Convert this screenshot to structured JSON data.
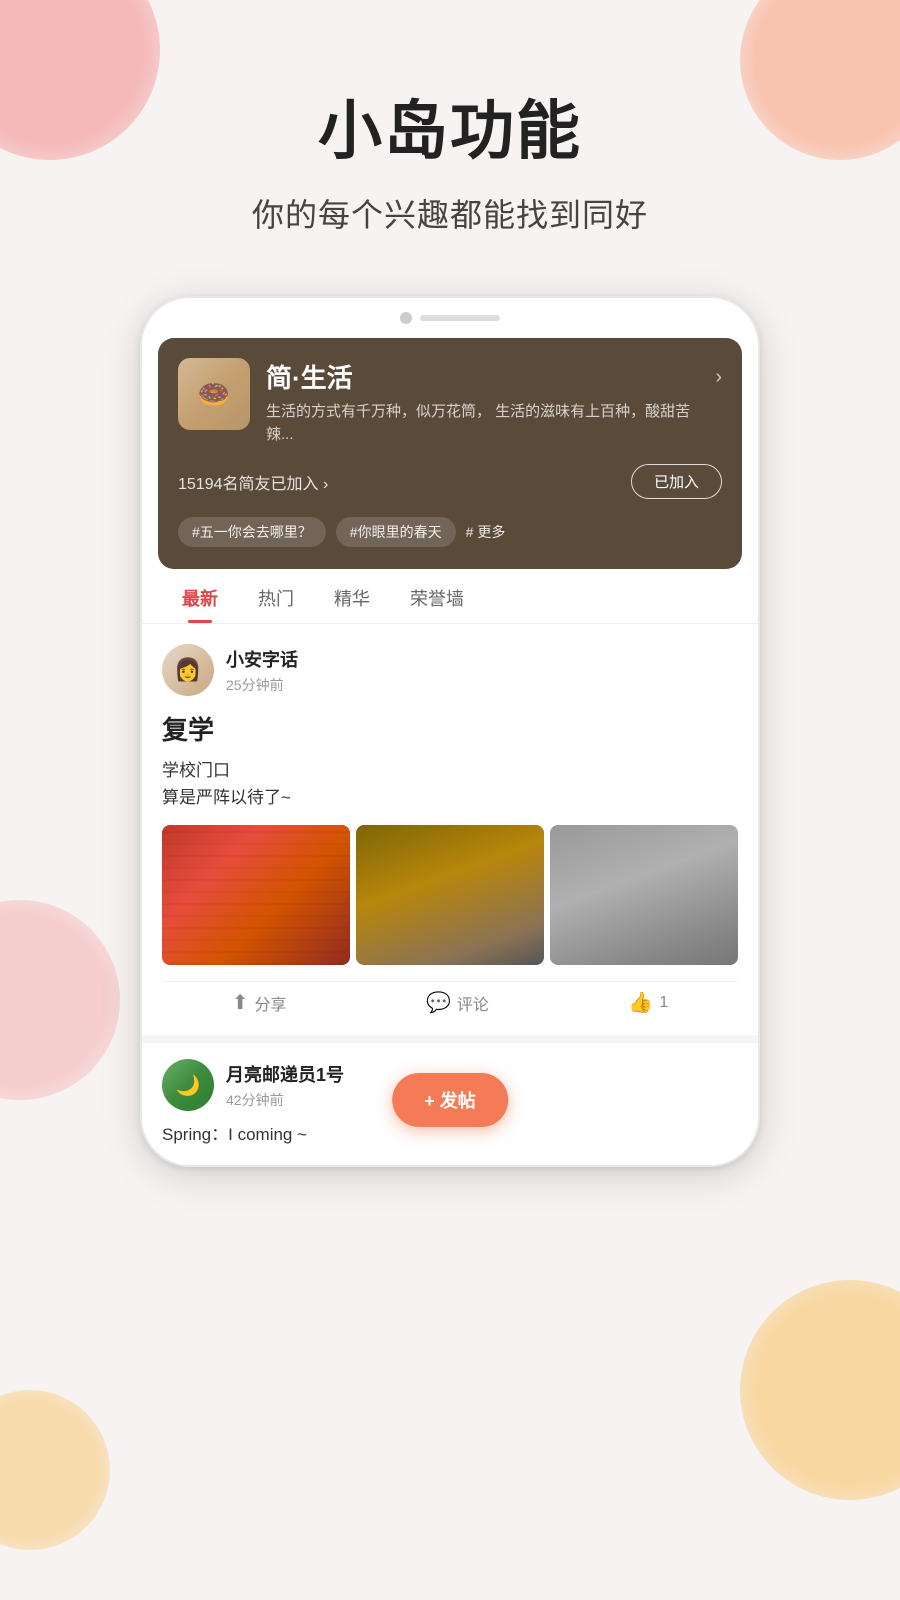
{
  "background": {
    "color": "#f7f3f2"
  },
  "header": {
    "title": "小岛功能",
    "subtitle": "你的每个兴趣都能找到同好"
  },
  "island": {
    "name": "简·生活",
    "description": "生活的方式有千万种，似万花筒，\n生活的滋味有上百种，酸甜苦辣...",
    "member_count": "15194名简友已加入 ›",
    "join_button": "已加入",
    "tags": [
      "#五一你会去哪里？",
      "#你眼里的春天",
      "#"
    ],
    "more_label": "更多",
    "chevron": "›"
  },
  "tabs": [
    {
      "label": "最新",
      "active": true
    },
    {
      "label": "热门",
      "active": false
    },
    {
      "label": "精华",
      "active": false
    },
    {
      "label": "荣誉墙",
      "active": false
    }
  ],
  "post1": {
    "username": "小安字话",
    "time": "25分钟前",
    "title": "复学",
    "content_line1": "学校门口",
    "content_line2": "算是严阵以待了~",
    "actions": {
      "share": "分享",
      "comment": "评论",
      "like": "1"
    }
  },
  "post2": {
    "username": "月亮邮递员1号",
    "time": "42分钟前",
    "content": "Spring：I coming ~"
  },
  "fab": {
    "label": "+ 发帖"
  },
  "bottom": {
    "coming_text": "coming ~"
  }
}
